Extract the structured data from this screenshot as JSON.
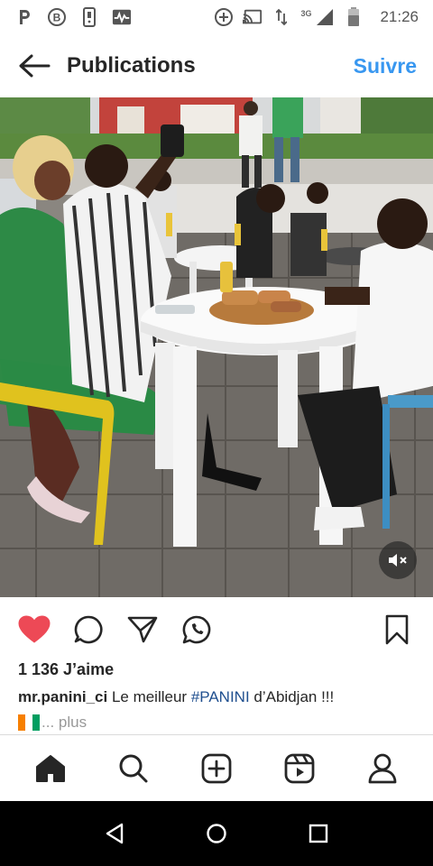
{
  "status_bar": {
    "time": "21:26",
    "network": "3G",
    "left_icons": [
      "parking-icon",
      "b-circle-icon",
      "phone-icon",
      "activity-icon"
    ],
    "right_icons": [
      "add-circle-icon",
      "cast-icon",
      "data-arrows-icon",
      "signal-icon",
      "battery-icon"
    ]
  },
  "header": {
    "title": "Publications",
    "follow_label": "Suivre"
  },
  "post": {
    "likes": "1 136 J’aime",
    "username": "mr.panini_ci",
    "caption_pre": "Le meilleur ",
    "hashtag": "#PANINI",
    "caption_post": " d’Abidjan !!!",
    "more_label": "... plus",
    "liked": true
  },
  "colors": {
    "accent": "#3897f0",
    "like_red": "#ed4956",
    "hashtag": "#1f4f8f",
    "flag_orange": "#f77f00",
    "flag_white": "#ffffff",
    "flag_green": "#009e60"
  },
  "bottom_nav": [
    "home-icon",
    "search-icon",
    "create-icon",
    "reels-icon",
    "profile-icon"
  ],
  "system_nav": [
    "back-triangle-icon",
    "home-circle-icon",
    "recents-square-icon"
  ]
}
